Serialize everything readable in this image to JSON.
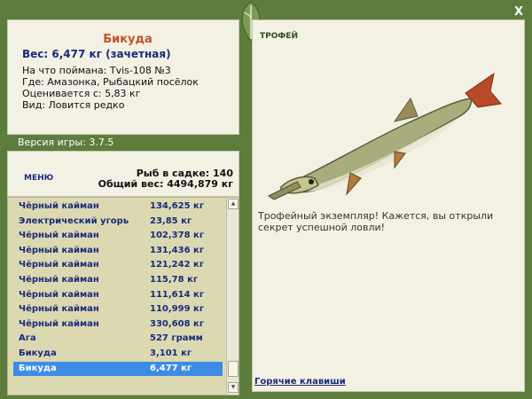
{
  "window": {
    "close_label": "X"
  },
  "fish_info": {
    "name": "Бикуда",
    "weight": "Вес: 6,477 кг (зачетная)",
    "bait": "На что поймана: Tvis-108 №3",
    "location": "Где: Амазонка, Рыбацкий посёлок",
    "rated": "Оценивается с: 5,83 кг",
    "rarity": "Вид: Ловится редко"
  },
  "version": "Версия игры: 3.7.5",
  "menu_label": "МЕНЮ",
  "keep": {
    "count_text": "Рыб в садке: 140",
    "total_text": "Общий вес: 4494,879 кг"
  },
  "catch_list": [
    {
      "name": "Чёрный кайман",
      "weight": "134,625 кг"
    },
    {
      "name": "Электрический угорь",
      "weight": "23,85 кг"
    },
    {
      "name": "Чёрный кайман",
      "weight": "102,378 кг"
    },
    {
      "name": "Чёрный кайман",
      "weight": "131,436 кг"
    },
    {
      "name": "Чёрный кайман",
      "weight": "121,242 кг"
    },
    {
      "name": "Чёрный кайман",
      "weight": "115,78 кг"
    },
    {
      "name": "Чёрный кайман",
      "weight": "111,614 кг"
    },
    {
      "name": "Чёрный кайман",
      "weight": "110,999 кг"
    },
    {
      "name": "Чёрный кайман",
      "weight": "330,608 кг"
    },
    {
      "name": "Ага",
      "weight": "527 грамм"
    },
    {
      "name": "Бикуда",
      "weight": "3,101 кг"
    },
    {
      "name": "Бикуда",
      "weight": "6,477 кг",
      "selected": true
    }
  ],
  "trophy": {
    "title": "ТРОФЕЙ",
    "text": "Трофейный экземпляр! Кажется, вы открыли секрет успешной ловли!",
    "hotkeys_label": "Горячие клавиши"
  },
  "colors": {
    "frame": "#5d7d3c",
    "panel": "#f2f1e4",
    "list_bg": "#dcd9b2",
    "selection": "#3d8ce6",
    "fish_name": "#c0542a",
    "text_blue": "#1a2b7a"
  }
}
